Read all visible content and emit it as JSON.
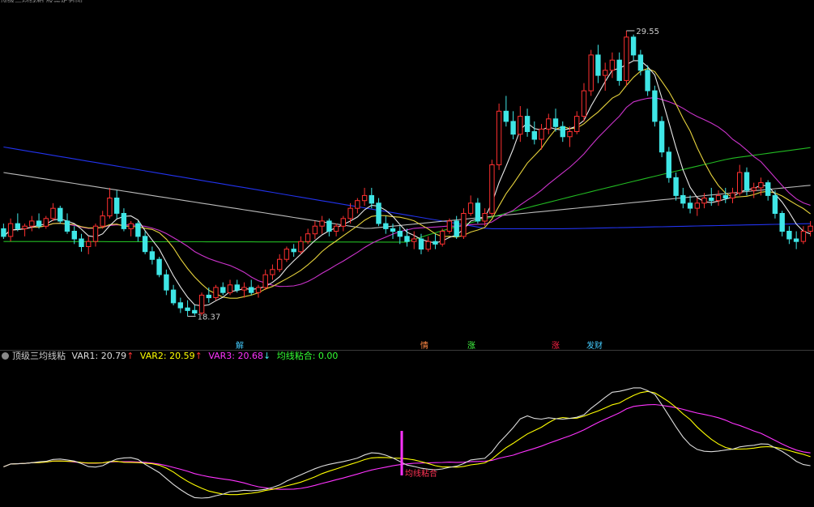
{
  "top_strip": "顶级三均线粘 股票走势图",
  "main_chart": {
    "high_label": "29.55",
    "low_label": "18.37",
    "signals": [
      {
        "text": "解",
        "color": "#44ccff"
      },
      {
        "text": "情",
        "color": "#ff8844"
      },
      {
        "text": "涨",
        "color": "#44ff44"
      },
      {
        "text": "涨",
        "color": "#ff2244"
      },
      {
        "text": "发财",
        "color": "#44ccff"
      }
    ]
  },
  "indicator": {
    "name": "顶级三均线粘",
    "var1_label": "VAR1: 20.79",
    "var1_arrow": "↑",
    "var2_label": "VAR2: 20.59",
    "var2_arrow": "↑",
    "var3_label": "VAR3: 20.68",
    "var3_arrow": "↓",
    "signal_label": "均线粘合: 0.00",
    "marker_text": "均线粘合"
  },
  "colors": {
    "up": "#ff3030",
    "down": "#3fe6e6",
    "var1": "#dddddd",
    "var2": "#ffff00",
    "var3": "#ff33ff",
    "signal": "#33ff33",
    "ma_white": "#e8e8e8",
    "ma_yellow": "#e6d23c",
    "ma_magenta": "#cc33cc",
    "ma_green": "#22bb22",
    "ma_gray": "#bbbbbb",
    "ma_blue": "#2233ee"
  },
  "chart_data": {
    "type": "candlestick",
    "price_range": [
      17.5,
      30.5
    ],
    "high": 29.55,
    "low": 18.37,
    "candles": [
      [
        21.8,
        22.0,
        21.4,
        21.5
      ],
      [
        21.5,
        22.2,
        21.3,
        22.0
      ],
      [
        22.0,
        22.4,
        21.7,
        21.8
      ],
      [
        21.8,
        22.0,
        21.5,
        21.9
      ],
      [
        21.9,
        22.3,
        21.7,
        22.1
      ],
      [
        22.1,
        22.4,
        21.8,
        21.9
      ],
      [
        21.9,
        22.3,
        21.8,
        22.2
      ],
      [
        22.2,
        22.8,
        22.1,
        22.6
      ],
      [
        22.6,
        22.7,
        22.0,
        22.1
      ],
      [
        22.1,
        22.4,
        21.6,
        21.7
      ],
      [
        21.7,
        21.9,
        21.2,
        21.4
      ],
      [
        21.4,
        21.6,
        20.9,
        21.1
      ],
      [
        21.1,
        21.5,
        20.8,
        21.3
      ],
      [
        21.3,
        22.0,
        21.1,
        21.9
      ],
      [
        21.9,
        22.5,
        21.8,
        22.3
      ],
      [
        22.3,
        23.4,
        22.2,
        23.0
      ],
      [
        23.0,
        23.3,
        22.2,
        22.4
      ],
      [
        22.4,
        22.6,
        21.7,
        21.8
      ],
      [
        21.8,
        22.1,
        21.5,
        22.0
      ],
      [
        22.0,
        22.1,
        21.3,
        21.5
      ],
      [
        21.5,
        21.7,
        20.8,
        20.9
      ],
      [
        20.9,
        21.1,
        20.4,
        20.6
      ],
      [
        20.6,
        20.7,
        19.9,
        20.0
      ],
      [
        20.0,
        20.2,
        19.2,
        19.4
      ],
      [
        19.4,
        19.6,
        18.8,
        18.9
      ],
      [
        18.9,
        19.1,
        18.5,
        18.7
      ],
      [
        18.7,
        19.0,
        18.37,
        18.6
      ],
      [
        18.6,
        18.8,
        18.4,
        18.5
      ],
      [
        18.5,
        19.3,
        18.4,
        19.2
      ],
      [
        19.2,
        19.5,
        18.9,
        19.1
      ],
      [
        19.1,
        19.6,
        19.0,
        19.5
      ],
      [
        19.5,
        19.7,
        19.2,
        19.3
      ],
      [
        19.3,
        19.8,
        19.2,
        19.6
      ],
      [
        19.6,
        19.8,
        19.3,
        19.4
      ],
      [
        19.4,
        19.7,
        19.1,
        19.5
      ],
      [
        19.5,
        19.8,
        19.2,
        19.3
      ],
      [
        19.3,
        19.6,
        19.1,
        19.5
      ],
      [
        19.5,
        20.2,
        19.4,
        20.0
      ],
      [
        20.0,
        20.4,
        19.8,
        20.2
      ],
      [
        20.2,
        20.8,
        20.1,
        20.6
      ],
      [
        20.6,
        21.1,
        20.5,
        21.0
      ],
      [
        21.0,
        21.2,
        20.7,
        20.9
      ],
      [
        20.9,
        21.5,
        20.8,
        21.3
      ],
      [
        21.3,
        21.8,
        21.2,
        21.6
      ],
      [
        21.6,
        22.1,
        21.4,
        21.9
      ],
      [
        21.9,
        22.3,
        21.6,
        22.1
      ],
      [
        22.1,
        22.2,
        21.5,
        21.7
      ],
      [
        21.7,
        22.0,
        21.5,
        21.9
      ],
      [
        21.9,
        22.3,
        21.7,
        22.2
      ],
      [
        22.2,
        22.8,
        22.0,
        22.6
      ],
      [
        22.6,
        23.0,
        22.4,
        22.9
      ],
      [
        22.9,
        23.4,
        22.7,
        23.1
      ],
      [
        23.1,
        23.4,
        22.6,
        22.8
      ],
      [
        22.8,
        23.0,
        21.9,
        22.0
      ],
      [
        22.0,
        22.3,
        21.6,
        21.8
      ],
      [
        21.8,
        22.0,
        21.4,
        21.7
      ],
      [
        21.7,
        21.9,
        21.2,
        21.5
      ],
      [
        21.5,
        21.8,
        21.1,
        21.3
      ],
      [
        21.3,
        21.7,
        21.0,
        21.4
      ],
      [
        21.4,
        21.6,
        20.8,
        21.0
      ],
      [
        21.0,
        21.5,
        20.9,
        21.3
      ],
      [
        21.3,
        21.6,
        21.0,
        21.2
      ],
      [
        21.2,
        21.8,
        21.1,
        21.7
      ],
      [
        21.7,
        22.2,
        21.6,
        22.1
      ],
      [
        22.1,
        22.3,
        21.4,
        21.5
      ],
      [
        21.5,
        22.6,
        21.4,
        22.4
      ],
      [
        22.4,
        23.1,
        22.3,
        22.8
      ],
      [
        22.8,
        23.0,
        22.0,
        22.1
      ],
      [
        22.1,
        22.6,
        21.9,
        22.4
      ],
      [
        22.4,
        24.5,
        22.3,
        24.3
      ],
      [
        24.3,
        26.7,
        24.1,
        26.4
      ],
      [
        26.4,
        27.0,
        25.8,
        26.0
      ],
      [
        26.0,
        26.4,
        25.3,
        25.5
      ],
      [
        25.5,
        26.6,
        25.2,
        26.2
      ],
      [
        26.2,
        26.5,
        25.4,
        25.6
      ],
      [
        25.6,
        26.0,
        25.1,
        25.3
      ],
      [
        25.3,
        25.9,
        24.9,
        25.7
      ],
      [
        25.7,
        26.3,
        25.5,
        26.1
      ],
      [
        26.1,
        26.5,
        25.6,
        25.8
      ],
      [
        25.8,
        26.0,
        25.2,
        25.4
      ],
      [
        25.4,
        25.8,
        25.0,
        25.6
      ],
      [
        25.6,
        26.4,
        25.5,
        26.2
      ],
      [
        26.2,
        27.5,
        26.0,
        27.2
      ],
      [
        27.2,
        28.8,
        27.0,
        28.6
      ],
      [
        28.6,
        29.0,
        27.5,
        27.8
      ],
      [
        27.8,
        28.3,
        27.2,
        28.0
      ],
      [
        28.0,
        28.7,
        27.7,
        28.4
      ],
      [
        28.4,
        28.7,
        27.4,
        27.6
      ],
      [
        27.6,
        29.55,
        27.4,
        29.3
      ],
      [
        29.3,
        29.4,
        28.4,
        28.6
      ],
      [
        28.6,
        28.8,
        27.8,
        28.0
      ],
      [
        28.0,
        28.2,
        27.0,
        27.2
      ],
      [
        27.2,
        27.4,
        25.8,
        26.0
      ],
      [
        26.0,
        26.2,
        24.6,
        24.8
      ],
      [
        24.8,
        25.0,
        23.6,
        23.8
      ],
      [
        23.8,
        24.0,
        22.9,
        23.1
      ],
      [
        23.1,
        23.4,
        22.6,
        22.8
      ],
      [
        22.8,
        23.1,
        22.4,
        22.6
      ],
      [
        22.6,
        23.0,
        22.3,
        22.8
      ],
      [
        22.8,
        23.2,
        22.6,
        23.0
      ],
      [
        23.0,
        23.4,
        22.7,
        22.9
      ],
      [
        22.9,
        23.3,
        22.7,
        23.1
      ],
      [
        23.1,
        23.4,
        22.8,
        23.0
      ],
      [
        23.0,
        23.4,
        22.8,
        23.2
      ],
      [
        23.2,
        24.3,
        23.1,
        24.0
      ],
      [
        24.0,
        24.2,
        23.1,
        23.3
      ],
      [
        23.3,
        23.6,
        23.0,
        23.4
      ],
      [
        23.4,
        23.8,
        23.1,
        23.6
      ],
      [
        23.6,
        23.7,
        22.9,
        23.1
      ],
      [
        23.1,
        23.3,
        22.2,
        22.4
      ],
      [
        22.4,
        22.5,
        21.5,
        21.7
      ],
      [
        21.7,
        21.9,
        21.2,
        21.4
      ],
      [
        21.4,
        21.7,
        21.0,
        21.3
      ],
      [
        21.3,
        21.9,
        21.2,
        21.7
      ],
      [
        21.7,
        22.1,
        21.5,
        21.9
      ]
    ],
    "ma": [
      {
        "color_key": "ma_white",
        "period": 5
      },
      {
        "color_key": "ma_yellow",
        "period": 10
      },
      {
        "color_key": "ma_magenta",
        "period": 20
      },
      {
        "color_key": "ma_green",
        "period": 60
      },
      {
        "color_key": "ma_gray",
        "period": 120
      },
      {
        "color_key": "ma_blue",
        "period": 250
      }
    ]
  }
}
